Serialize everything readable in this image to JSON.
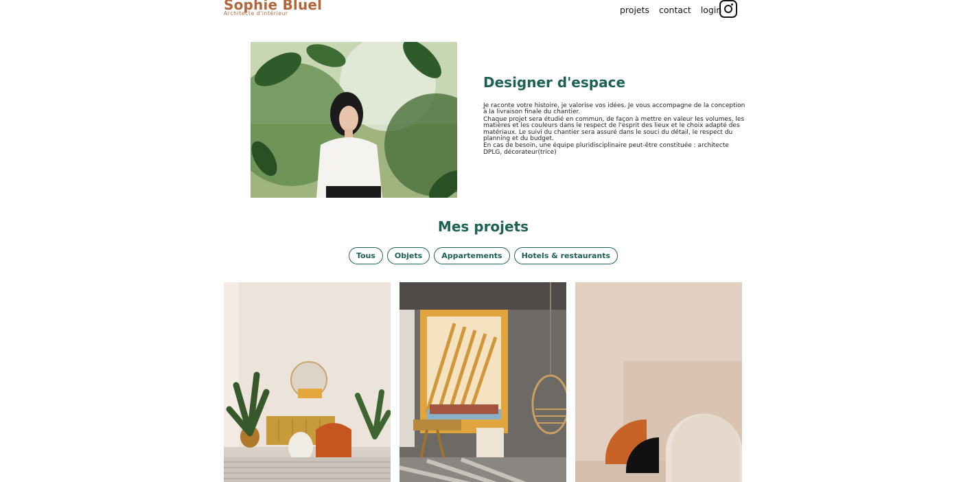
{
  "header": {
    "logo_title": "Sophie Bluel",
    "logo_subtitle": "Architecte d'intérieur",
    "nav": [
      "projets",
      "contact",
      "login"
    ],
    "social_icon": "instagram-icon"
  },
  "intro": {
    "title": "Designer d'espace",
    "paragraphs": [
      "Je raconte votre histoire, je valorise vos idées. Je vous accompagne de la conception à la livraison finale du chantier.",
      "Chaque projet sera étudié en commun, de façon à mettre en valeur les volumes, les matières et les couleurs dans le respect de l'esprit des lieux et le choix adapté des matériaux. Le suivi du chantier sera assuré dans le souci du détail, le respect du planning et du budget.",
      "En cas de besoin, une équipe pluridisciplinaire peut-être constituée : architecte DPLG, décorateur(trice)"
    ]
  },
  "projects": {
    "title": "Mes projets",
    "filters": [
      "Tous",
      "Objets",
      "Appartements",
      "Hotels & restaurants"
    ]
  },
  "colors": {
    "brand": "#b1663c",
    "accent": "#1d6154"
  }
}
